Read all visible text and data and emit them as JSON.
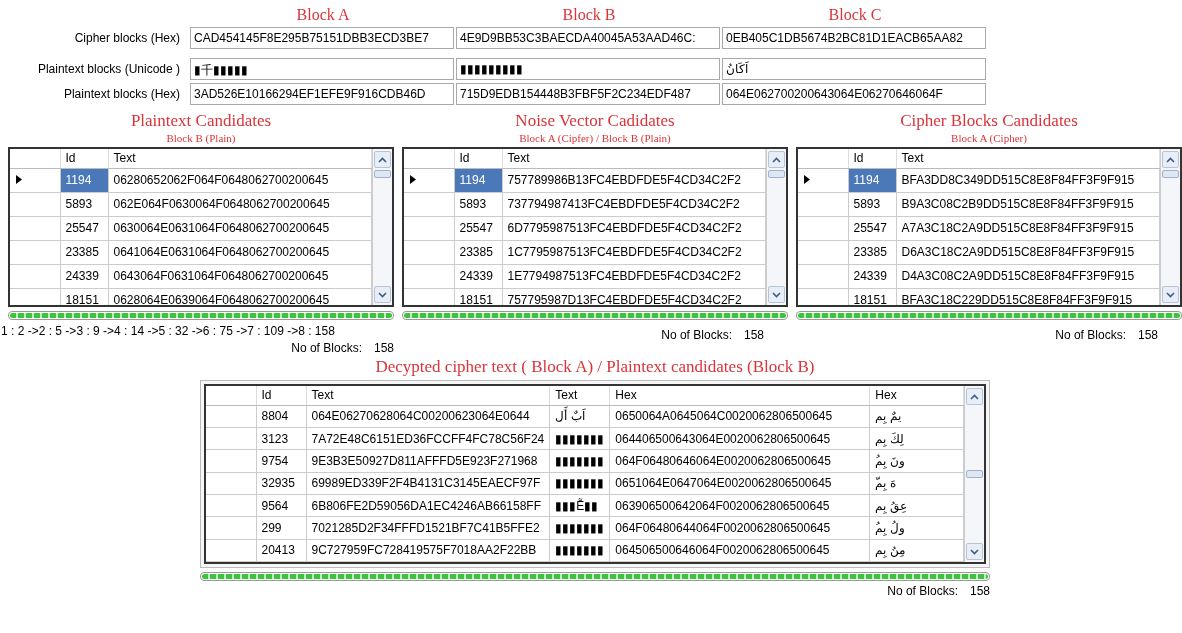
{
  "blocks": {
    "headings": [
      "Block A",
      "Block B",
      "Block C"
    ],
    "rows": [
      {
        "label": "Cipher blocks (Hex)",
        "values": [
          "CAD454145F8E295B75151DBB3ECD3BE7",
          "4E9D9BB53C3BAECDA40045A53AAD46C:",
          "0EB405C1DB5674B2BC81D1EACB65AA82"
        ]
      },
      {
        "label": "Plaintext blocks (Unicode )",
        "values": [
          "▮千▮▮▮▮▮",
          "▮▮▮▮▮▮▮▮▮",
          "اَكَانُ"
        ]
      },
      {
        "label": "Plaintext blocks (Hex)",
        "values": [
          "3AD526E10166294EF1EFE9F916CDB46D",
          "715D9EDB154448B3FBF5F2C234EDF487",
          "064E062700200643064E06270646064F"
        ]
      }
    ]
  },
  "panels": [
    {
      "title": "Plaintext Candidates",
      "subtitle": "Block B (Plain)",
      "columns": [
        "Id",
        "Text"
      ],
      "rows": [
        {
          "id": "1194",
          "text": "06280652062F064F0648062700200645",
          "selected": true
        },
        {
          "id": "5893",
          "text": "062E064F0630064F0648062700200645",
          "selected": false
        },
        {
          "id": "25547",
          "text": "0630064E0631064F0648062700200645",
          "selected": false
        },
        {
          "id": "23385",
          "text": "0641064E0631064F0648062700200645",
          "selected": false
        },
        {
          "id": "24339",
          "text": "0643064F0631064F0648062700200645",
          "selected": false
        },
        {
          "id": "18151",
          "text": "0628064E0639064F0648062700200645",
          "selected": false
        }
      ],
      "progress": {
        "level": 1
      },
      "sequence": "1 : 2 ->2 : 5 ->3 : 9 ->4 : 14 ->5 : 32 ->6 : 75 ->7 : 109 ->8 : 158",
      "count_label": "No of Blocks:",
      "count": "158"
    },
    {
      "title": "Noise Vector Cadidates",
      "subtitle": "Block A (Cipfer) / Block B (Plain)",
      "columns": [
        "Id",
        "Text"
      ],
      "rows": [
        {
          "id": "1194",
          "text": "757789986B13FC4EBDFDE5F4CD34C2F2",
          "selected": true
        },
        {
          "id": "5893",
          "text": "737794987413FC4EBDFDE5F4CD34C2F2",
          "selected": false
        },
        {
          "id": "25547",
          "text": "6D7795987513FC4EBDFDE5F4CD34C2F2",
          "selected": false
        },
        {
          "id": "23385",
          "text": "1C7795987513FC4EBDFDE5F4CD34C2F2",
          "selected": false
        },
        {
          "id": "24339",
          "text": "1E7794987513FC4EBDFDE5F4CD34C2F2",
          "selected": false
        },
        {
          "id": "18151",
          "text": "757795987D13FC4EBDFDE5F4CD34C2F2",
          "selected": false
        }
      ],
      "progress": {
        "level": 1
      },
      "count_label": "No of Blocks:",
      "count": "158"
    },
    {
      "title": "Cipher Blocks Candidates",
      "subtitle": "Block A (Cipher)",
      "columns": [
        "Id",
        "Text"
      ],
      "rows": [
        {
          "id": "1194",
          "text": "BFA3DD8C349DD515C8E8F84FF3F9F915",
          "selected": true
        },
        {
          "id": "5893",
          "text": "B9A3C08C2B9DD515C8E8F84FF3F9F915",
          "selected": false
        },
        {
          "id": "25547",
          "text": "A7A3C18C2A9DD515C8E8F84FF3F9F915",
          "selected": false
        },
        {
          "id": "23385",
          "text": "D6A3C18C2A9DD515C8E8F84FF3F9F915",
          "selected": false
        },
        {
          "id": "24339",
          "text": "D4A3C08C2A9DD515C8E8F84FF3F9F915",
          "selected": false
        },
        {
          "id": "18151",
          "text": "BFA3C18C229DD515C8E8F84FF3F9F915",
          "selected": false
        }
      ],
      "progress": {
        "level": 1
      },
      "count_label": "No of Blocks:",
      "count": "158"
    }
  ],
  "decrypted": {
    "title": "Decypted cipher text ( Block A) / Plaintext candidates (Block B)",
    "columns": [
      "Id",
      "Text",
      "Text",
      "Hex",
      "Hex"
    ],
    "rows": [
      {
        "cells": [
          "8804",
          "064E06270628064C00200623064E0644",
          "اَبٌ أَل",
          "0650064A0645064C0020062806500645",
          "يمٌ بِم"
        ],
        "selected": false
      },
      {
        "cells": [
          "3123",
          "7A72E48C6151ED36FCCFF4FC78C56F24",
          "▮▮▮▮▮▮▮",
          "064406500643064E0020062806500645",
          "لِكَ بِم"
        ],
        "selected": false
      },
      {
        "cells": [
          "9754",
          "9E3B3E50927D811AFFFD5E923F271968",
          "▮▮▮▮▮▮▮",
          "064F06480646064E0020062806500645",
          "ُونَ بِم"
        ],
        "selected": false
      },
      {
        "cells": [
          "32935",
          "69989ED339F2F4B4131C3145EAECF97F",
          "▮▮▮▮▮▮▮",
          "0651064E0647064E0020062806500645",
          "ّهَ بِم"
        ],
        "selected": false
      },
      {
        "cells": [
          "9564",
          "6B806FE2D59056DA1EC4246AB66158FF",
          "▮▮▮Ễ▮▮",
          "063906500642064F0020062806500645",
          "عِقُ بِم"
        ],
        "selected": false
      },
      {
        "cells": [
          "299",
          "7021285D2F34FFFD1521BF7C41B5FFE2",
          "▮▮▮▮▮▮▮",
          "064F06480644064F0020062806500645",
          "ُولُ بِم"
        ],
        "selected": false
      },
      {
        "cells": [
          "20413",
          "9C727959FC728419575F7018AA2F22BB",
          "▮▮▮▮▮▮▮",
          "064506500646064F0020062806500645",
          "مِنُ بِم"
        ],
        "selected": false
      }
    ],
    "progress": {
      "level": 1
    },
    "count_label": "No of Blocks:",
    "count": "158"
  }
}
